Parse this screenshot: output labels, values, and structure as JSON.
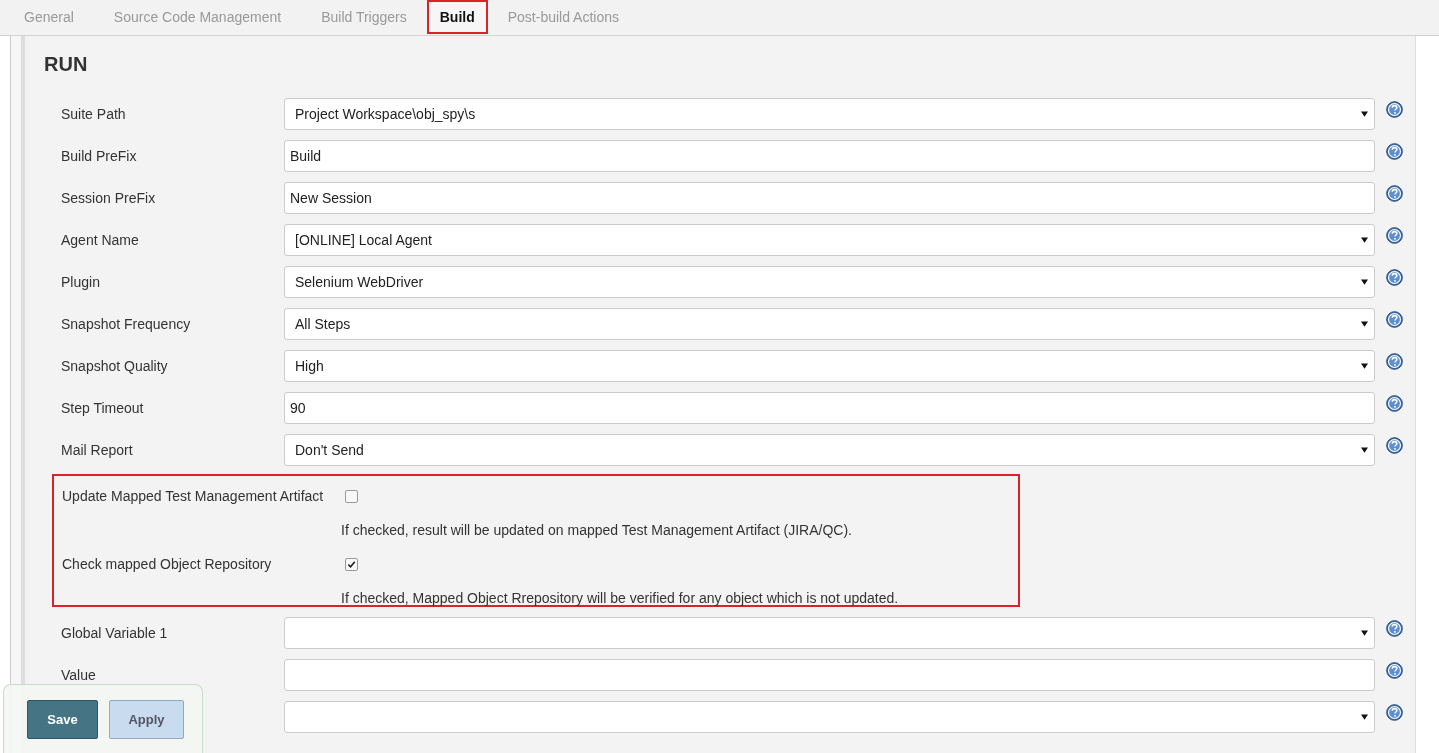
{
  "tabs": [
    {
      "label": "General",
      "selected": false
    },
    {
      "label": "Source Code Management",
      "selected": false
    },
    {
      "label": "Build Triggers",
      "selected": false
    },
    {
      "label": "Build",
      "selected": true
    },
    {
      "label": "Post-build Actions",
      "selected": false
    }
  ],
  "section": {
    "title": "RUN",
    "fields": [
      {
        "label": "Suite Path",
        "kind": "select",
        "value": "Project Workspace\\obj_spy\\s"
      },
      {
        "label": "Build PreFix",
        "kind": "text",
        "value": "Build"
      },
      {
        "label": "Session PreFix",
        "kind": "text",
        "value": "New Session"
      },
      {
        "label": "Agent Name",
        "kind": "select",
        "value": "[ONLINE] Local Agent"
      },
      {
        "label": "Plugin",
        "kind": "select",
        "value": "Selenium WebDriver"
      },
      {
        "label": "Snapshot Frequency",
        "kind": "select",
        "value": "All Steps"
      },
      {
        "label": "Snapshot Quality",
        "kind": "select",
        "value": "High"
      },
      {
        "label": "Step Timeout",
        "kind": "text",
        "value": "90"
      },
      {
        "label": "Mail Report",
        "kind": "select",
        "value": "Don't Send"
      }
    ],
    "options": {
      "highlighted": true,
      "items": [
        {
          "label": "Update Mapped Test Management Artifact",
          "checked": false,
          "help": "If checked, result will be updated on mapped Test Management Artifact (JIRA/QC)."
        },
        {
          "label": "Check mapped Object Repository",
          "checked": true,
          "help": "If checked, Mapped Object Rrepository will be verified for any object which is not updated."
        }
      ]
    },
    "more_fields": [
      {
        "label": "Global Variable 1",
        "kind": "select"
      },
      {
        "label": "Value",
        "kind": "text"
      },
      {
        "kind": "select"
      }
    ]
  },
  "buttons": [
    {
      "label": "Save",
      "kind": "primary"
    },
    {
      "label": "Apply",
      "kind": "secondary"
    }
  ]
}
